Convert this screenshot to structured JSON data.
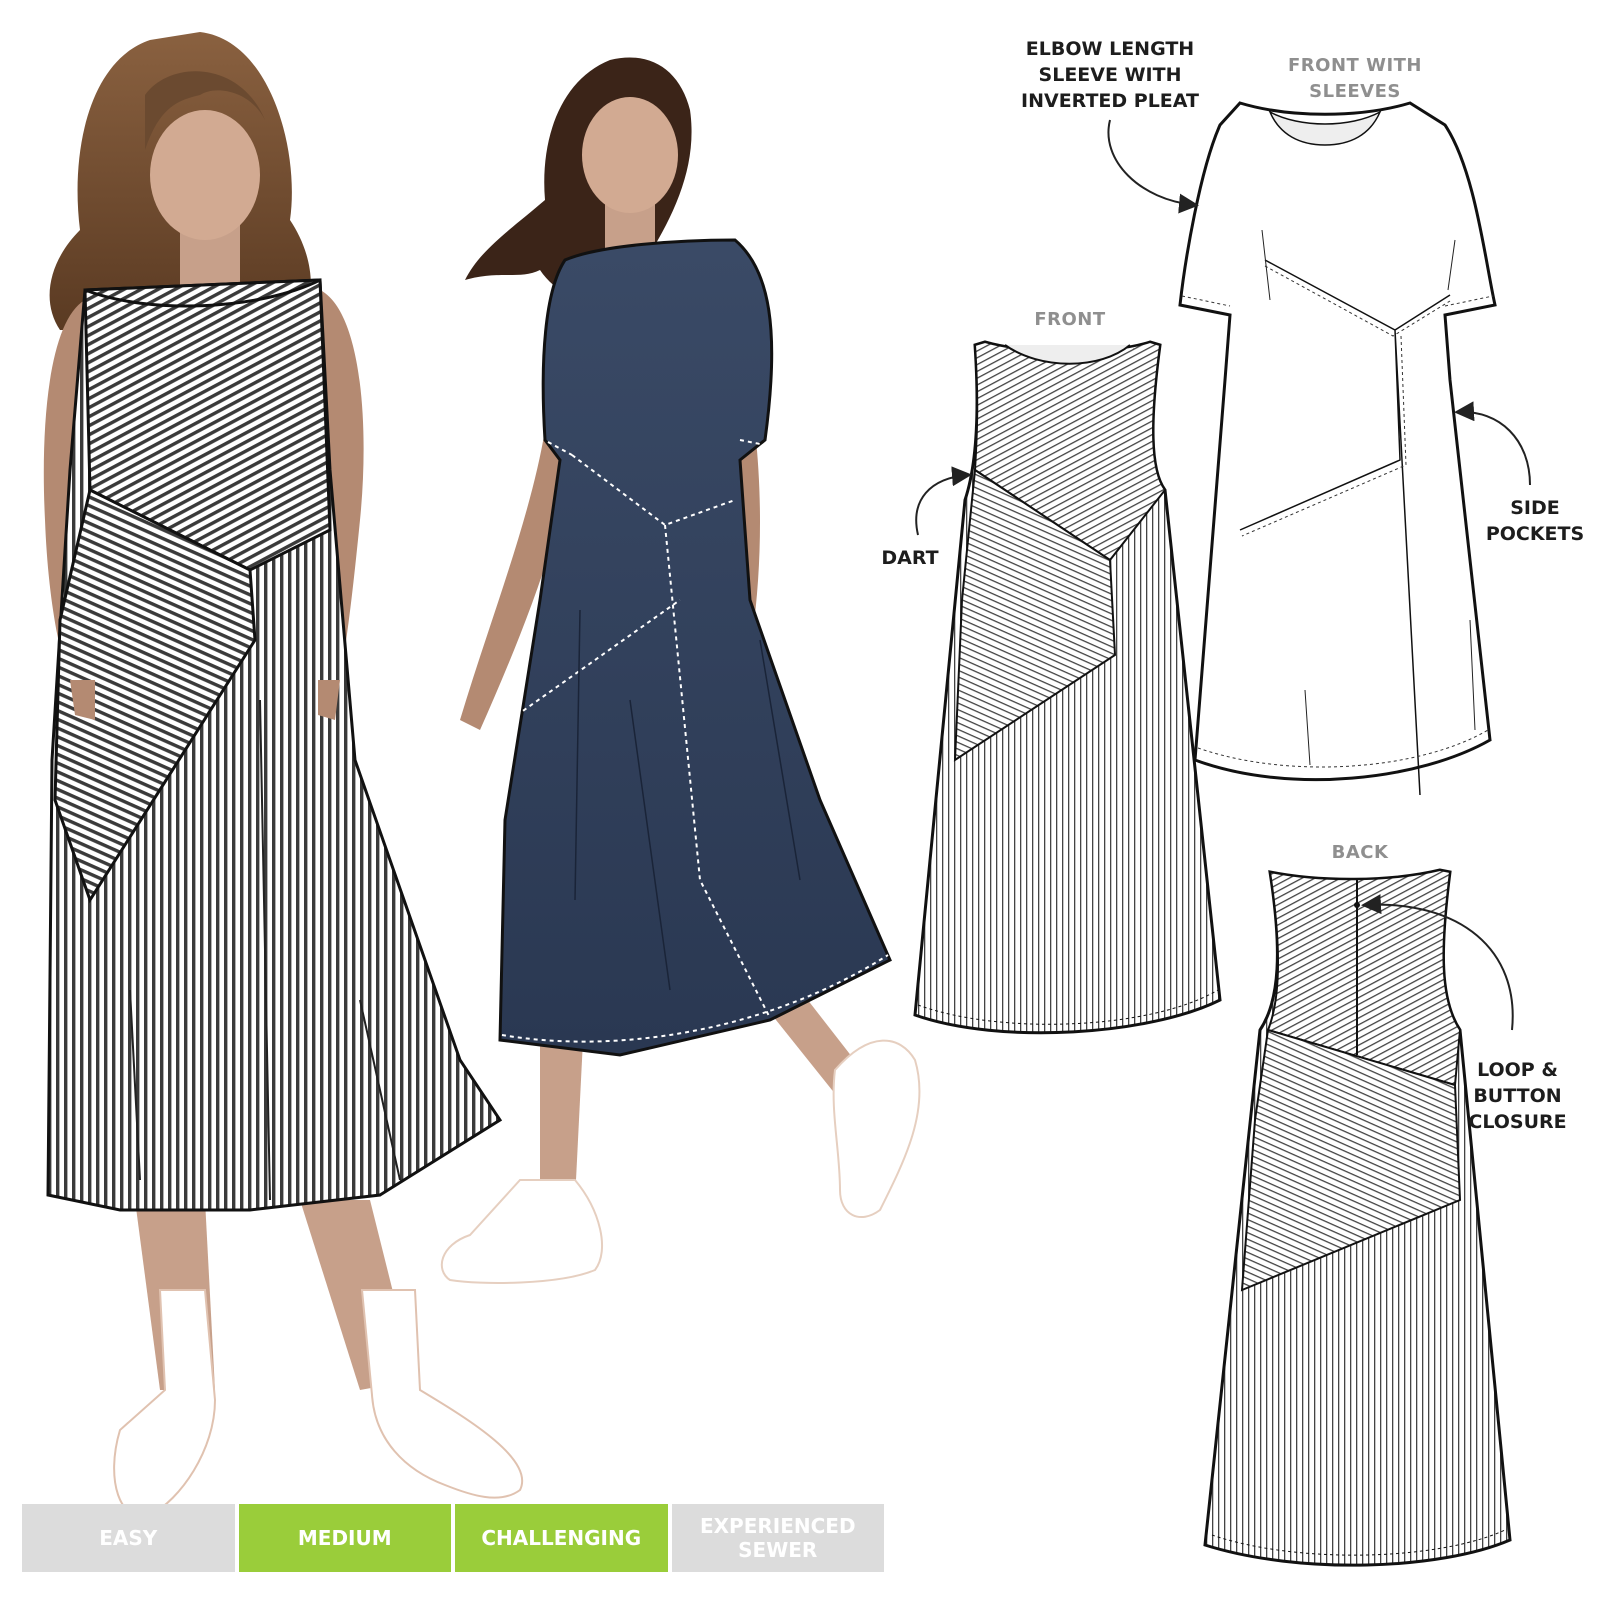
{
  "colors": {
    "skin": "#c7a08a",
    "hair": "#6b4a30",
    "hair_dark": "#3b2418",
    "navy": "#2f3f5c",
    "stripe_dark": "#3a3a3a",
    "level_active": "#9acd3a",
    "level_inactive": "#dcdcdc",
    "label_grey": "#8f8f8f"
  },
  "labels": {
    "elbow_sleeve": [
      "ELBOW LENGTH",
      "SLEEVE WITH",
      "INVERTED PLEAT"
    ],
    "front_with_sleeves": [
      "FRONT WITH",
      "SLEEVES"
    ],
    "front": "FRONT",
    "back": "BACK",
    "dart": "DART",
    "side_pockets": [
      "SIDE",
      "POCKETS"
    ],
    "loop_button": [
      "LOOP &",
      "BUTTON",
      "CLOSURE"
    ]
  },
  "difficulty": {
    "levels": [
      {
        "label": [
          "EASY"
        ],
        "active": false
      },
      {
        "label": [
          "MEDIUM"
        ],
        "active": true
      },
      {
        "label": [
          "CHALLENGING"
        ],
        "active": true
      },
      {
        "label": [
          "EXPERIENCED",
          "SEWER"
        ],
        "active": false
      }
    ]
  }
}
